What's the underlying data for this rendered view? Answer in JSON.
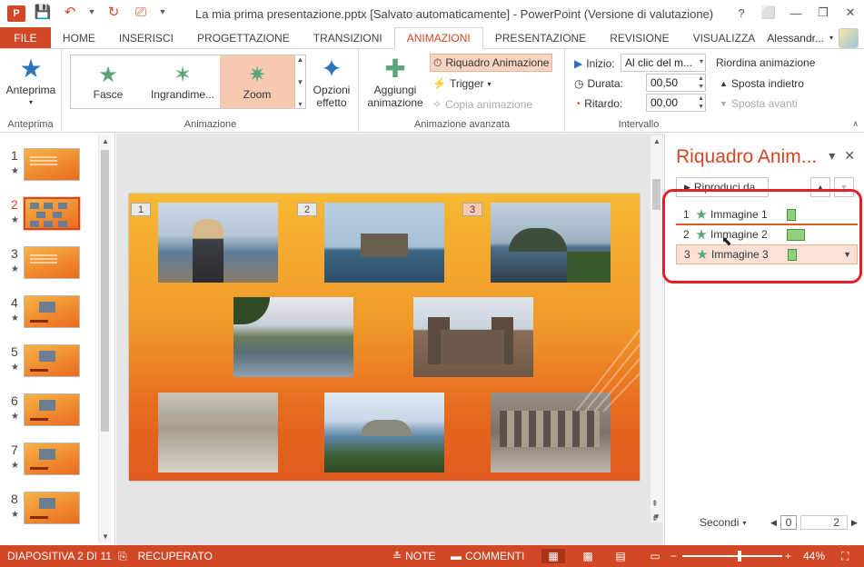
{
  "app": {
    "icon": "P",
    "title": "La mia prima presentazione.pptx [Salvato automaticamente] - PowerPoint (Versione di valutazione)",
    "window_controls": [
      "?",
      "⬜",
      "—",
      "❐",
      "✕"
    ]
  },
  "quick_access": {
    "icons": [
      "save-icon",
      "undo-icon",
      "redo-icon",
      "present-icon",
      "customize-icon"
    ]
  },
  "tabs": [
    "FILE",
    "HOME",
    "INSERISCI",
    "PROGETTAZIONE",
    "TRANSIZIONI",
    "ANIMAZIONI",
    "PRESENTAZIONE",
    "REVISIONE",
    "VISUALIZZA"
  ],
  "active_tab": "ANIMAZIONI",
  "user": {
    "name": "Alessandr..."
  },
  "ribbon": {
    "anteprima": {
      "button": "Anteprima",
      "group": "Anteprima"
    },
    "animazione": {
      "gallery": [
        "Fasce",
        "Ingrandime...",
        "Zoom"
      ],
      "selected": "Zoom",
      "opzioni": "Opzioni",
      "effetto": "effetto",
      "group": "Animazione"
    },
    "avanzata": {
      "aggiungi": "Aggiungi",
      "animazione": "animazione",
      "riquadro": "Riquadro Animazione",
      "trigger": "Trigger",
      "copia": "Copia animazione",
      "group": "Animazione avanzata"
    },
    "intervallo": {
      "inizio_label": "Inizio:",
      "inizio_value": "Al clic del m...",
      "durata_label": "Durata:",
      "durata_value": "00,50",
      "ritardo_label": "Ritardo:",
      "ritardo_value": "00,00",
      "riordina": "Riordina animazione",
      "indietro": "Sposta indietro",
      "avanti": "Sposta avanti",
      "group": "Intervallo"
    }
  },
  "thumbnails": [
    {
      "num": "1",
      "star": "★"
    },
    {
      "num": "2",
      "star": "★"
    },
    {
      "num": "3",
      "star": "★"
    },
    {
      "num": "4",
      "star": "★"
    },
    {
      "num": "5",
      "star": "★"
    },
    {
      "num": "6",
      "star": "★"
    },
    {
      "num": "7",
      "star": "★"
    },
    {
      "num": "8",
      "star": "★"
    }
  ],
  "selected_slide": "2",
  "slide": {
    "tags": [
      "1",
      "2",
      "3"
    ]
  },
  "pane": {
    "title": "Riquadro Anim...",
    "play": "Riproduci da",
    "items": [
      {
        "num": "1",
        "label": "Immagine 1"
      },
      {
        "num": "2",
        "label": "Immagine 2"
      },
      {
        "num": "3",
        "label": "Immagine 3"
      }
    ],
    "seconds": "Secondi",
    "timeline_start": "0",
    "timeline_end": "2"
  },
  "status": {
    "slide": "DIAPOSITIVA 2 DI 11",
    "recovered": "RECUPERATO",
    "notes": "NOTE",
    "comments": "COMMENTI",
    "zoom": "44%"
  },
  "colors": {
    "accent": "#d24726",
    "highlight": "#f8c9b1",
    "outline": "#e0202a"
  }
}
